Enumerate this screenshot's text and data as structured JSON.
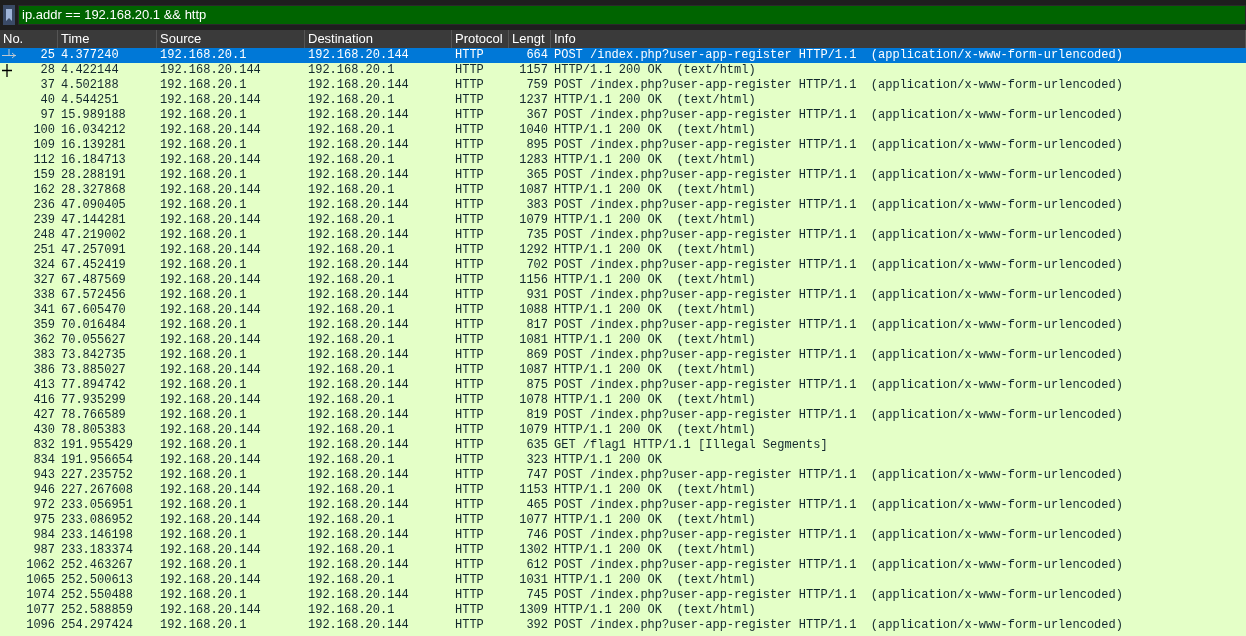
{
  "filter": {
    "value": "ip.addr == 192.168.20.1 && http"
  },
  "table": {
    "columns": [
      "No.",
      "Time",
      "Source",
      "Destination",
      "Protocol",
      "Lengt",
      "Info"
    ],
    "rows": [
      {
        "no": "25",
        "time": "4.377240",
        "source": "192.168.20.1",
        "destination": "192.168.20.144",
        "protocol": "HTTP",
        "length": "664",
        "info": "POST /index.php?user-app-register HTTP/1.1  (application/x-www-form-urlencoded)",
        "selected": true,
        "kind": "request"
      },
      {
        "no": "28",
        "time": "4.422144",
        "source": "192.168.20.144",
        "destination": "192.168.20.1",
        "protocol": "HTTP",
        "length": "1157",
        "info": "HTTP/1.1 200 OK  (text/html)",
        "selected": false,
        "kind": "response"
      },
      {
        "no": "37",
        "time": "4.502188",
        "source": "192.168.20.1",
        "destination": "192.168.20.144",
        "protocol": "HTTP",
        "length": "759",
        "info": "POST /index.php?user-app-register HTTP/1.1  (application/x-www-form-urlencoded)",
        "selected": false
      },
      {
        "no": "40",
        "time": "4.544251",
        "source": "192.168.20.144",
        "destination": "192.168.20.1",
        "protocol": "HTTP",
        "length": "1237",
        "info": "HTTP/1.1 200 OK  (text/html)",
        "selected": false
      },
      {
        "no": "97",
        "time": "15.989188",
        "source": "192.168.20.1",
        "destination": "192.168.20.144",
        "protocol": "HTTP",
        "length": "367",
        "info": "POST /index.php?user-app-register HTTP/1.1  (application/x-www-form-urlencoded)",
        "selected": false
      },
      {
        "no": "100",
        "time": "16.034212",
        "source": "192.168.20.144",
        "destination": "192.168.20.1",
        "protocol": "HTTP",
        "length": "1040",
        "info": "HTTP/1.1 200 OK  (text/html)",
        "selected": false
      },
      {
        "no": "109",
        "time": "16.139281",
        "source": "192.168.20.1",
        "destination": "192.168.20.144",
        "protocol": "HTTP",
        "length": "895",
        "info": "POST /index.php?user-app-register HTTP/1.1  (application/x-www-form-urlencoded)",
        "selected": false
      },
      {
        "no": "112",
        "time": "16.184713",
        "source": "192.168.20.144",
        "destination": "192.168.20.1",
        "protocol": "HTTP",
        "length": "1283",
        "info": "HTTP/1.1 200 OK  (text/html)",
        "selected": false
      },
      {
        "no": "159",
        "time": "28.288191",
        "source": "192.168.20.1",
        "destination": "192.168.20.144",
        "protocol": "HTTP",
        "length": "365",
        "info": "POST /index.php?user-app-register HTTP/1.1  (application/x-www-form-urlencoded)",
        "selected": false
      },
      {
        "no": "162",
        "time": "28.327868",
        "source": "192.168.20.144",
        "destination": "192.168.20.1",
        "protocol": "HTTP",
        "length": "1087",
        "info": "HTTP/1.1 200 OK  (text/html)",
        "selected": false
      },
      {
        "no": "236",
        "time": "47.090405",
        "source": "192.168.20.1",
        "destination": "192.168.20.144",
        "protocol": "HTTP",
        "length": "383",
        "info": "POST /index.php?user-app-register HTTP/1.1  (application/x-www-form-urlencoded)",
        "selected": false
      },
      {
        "no": "239",
        "time": "47.144281",
        "source": "192.168.20.144",
        "destination": "192.168.20.1",
        "protocol": "HTTP",
        "length": "1079",
        "info": "HTTP/1.1 200 OK  (text/html)",
        "selected": false
      },
      {
        "no": "248",
        "time": "47.219002",
        "source": "192.168.20.1",
        "destination": "192.168.20.144",
        "protocol": "HTTP",
        "length": "735",
        "info": "POST /index.php?user-app-register HTTP/1.1  (application/x-www-form-urlencoded)",
        "selected": false
      },
      {
        "no": "251",
        "time": "47.257091",
        "source": "192.168.20.144",
        "destination": "192.168.20.1",
        "protocol": "HTTP",
        "length": "1292",
        "info": "HTTP/1.1 200 OK  (text/html)",
        "selected": false
      },
      {
        "no": "324",
        "time": "67.452419",
        "source": "192.168.20.1",
        "destination": "192.168.20.144",
        "protocol": "HTTP",
        "length": "702",
        "info": "POST /index.php?user-app-register HTTP/1.1  (application/x-www-form-urlencoded)",
        "selected": false
      },
      {
        "no": "327",
        "time": "67.487569",
        "source": "192.168.20.144",
        "destination": "192.168.20.1",
        "protocol": "HTTP",
        "length": "1156",
        "info": "HTTP/1.1 200 OK  (text/html)",
        "selected": false
      },
      {
        "no": "338",
        "time": "67.572456",
        "source": "192.168.20.1",
        "destination": "192.168.20.144",
        "protocol": "HTTP",
        "length": "931",
        "info": "POST /index.php?user-app-register HTTP/1.1  (application/x-www-form-urlencoded)",
        "selected": false
      },
      {
        "no": "341",
        "time": "67.605470",
        "source": "192.168.20.144",
        "destination": "192.168.20.1",
        "protocol": "HTTP",
        "length": "1088",
        "info": "HTTP/1.1 200 OK  (text/html)",
        "selected": false
      },
      {
        "no": "359",
        "time": "70.016484",
        "source": "192.168.20.1",
        "destination": "192.168.20.144",
        "protocol": "HTTP",
        "length": "817",
        "info": "POST /index.php?user-app-register HTTP/1.1  (application/x-www-form-urlencoded)",
        "selected": false
      },
      {
        "no": "362",
        "time": "70.055627",
        "source": "192.168.20.144",
        "destination": "192.168.20.1",
        "protocol": "HTTP",
        "length": "1081",
        "info": "HTTP/1.1 200 OK  (text/html)",
        "selected": false
      },
      {
        "no": "383",
        "time": "73.842735",
        "source": "192.168.20.1",
        "destination": "192.168.20.144",
        "protocol": "HTTP",
        "length": "869",
        "info": "POST /index.php?user-app-register HTTP/1.1  (application/x-www-form-urlencoded)",
        "selected": false
      },
      {
        "no": "386",
        "time": "73.885027",
        "source": "192.168.20.144",
        "destination": "192.168.20.1",
        "protocol": "HTTP",
        "length": "1087",
        "info": "HTTP/1.1 200 OK  (text/html)",
        "selected": false
      },
      {
        "no": "413",
        "time": "77.894742",
        "source": "192.168.20.1",
        "destination": "192.168.20.144",
        "protocol": "HTTP",
        "length": "875",
        "info": "POST /index.php?user-app-register HTTP/1.1  (application/x-www-form-urlencoded)",
        "selected": false
      },
      {
        "no": "416",
        "time": "77.935299",
        "source": "192.168.20.144",
        "destination": "192.168.20.1",
        "protocol": "HTTP",
        "length": "1078",
        "info": "HTTP/1.1 200 OK  (text/html)",
        "selected": false
      },
      {
        "no": "427",
        "time": "78.766589",
        "source": "192.168.20.1",
        "destination": "192.168.20.144",
        "protocol": "HTTP",
        "length": "819",
        "info": "POST /index.php?user-app-register HTTP/1.1  (application/x-www-form-urlencoded)",
        "selected": false
      },
      {
        "no": "430",
        "time": "78.805383",
        "source": "192.168.20.144",
        "destination": "192.168.20.1",
        "protocol": "HTTP",
        "length": "1079",
        "info": "HTTP/1.1 200 OK  (text/html)",
        "selected": false
      },
      {
        "no": "832",
        "time": "191.955429",
        "source": "192.168.20.1",
        "destination": "192.168.20.144",
        "protocol": "HTTP",
        "length": "635",
        "info": "GET /flag1 HTTP/1.1 [Illegal Segments]",
        "selected": false
      },
      {
        "no": "834",
        "time": "191.956654",
        "source": "192.168.20.144",
        "destination": "192.168.20.1",
        "protocol": "HTTP",
        "length": "323",
        "info": "HTTP/1.1 200 OK",
        "selected": false
      },
      {
        "no": "943",
        "time": "227.235752",
        "source": "192.168.20.1",
        "destination": "192.168.20.144",
        "protocol": "HTTP",
        "length": "747",
        "info": "POST /index.php?user-app-register HTTP/1.1  (application/x-www-form-urlencoded)",
        "selected": false
      },
      {
        "no": "946",
        "time": "227.267608",
        "source": "192.168.20.144",
        "destination": "192.168.20.1",
        "protocol": "HTTP",
        "length": "1153",
        "info": "HTTP/1.1 200 OK  (text/html)",
        "selected": false
      },
      {
        "no": "972",
        "time": "233.056951",
        "source": "192.168.20.1",
        "destination": "192.168.20.144",
        "protocol": "HTTP",
        "length": "465",
        "info": "POST /index.php?user-app-register HTTP/1.1  (application/x-www-form-urlencoded)",
        "selected": false
      },
      {
        "no": "975",
        "time": "233.086952",
        "source": "192.168.20.144",
        "destination": "192.168.20.1",
        "protocol": "HTTP",
        "length": "1077",
        "info": "HTTP/1.1 200 OK  (text/html)",
        "selected": false
      },
      {
        "no": "984",
        "time": "233.146198",
        "source": "192.168.20.1",
        "destination": "192.168.20.144",
        "protocol": "HTTP",
        "length": "746",
        "info": "POST /index.php?user-app-register HTTP/1.1  (application/x-www-form-urlencoded)",
        "selected": false
      },
      {
        "no": "987",
        "time": "233.183374",
        "source": "192.168.20.144",
        "destination": "192.168.20.1",
        "protocol": "HTTP",
        "length": "1302",
        "info": "HTTP/1.1 200 OK  (text/html)",
        "selected": false
      },
      {
        "no": "1062",
        "time": "252.463267",
        "source": "192.168.20.1",
        "destination": "192.168.20.144",
        "protocol": "HTTP",
        "length": "612",
        "info": "POST /index.php?user-app-register HTTP/1.1  (application/x-www-form-urlencoded)",
        "selected": false
      },
      {
        "no": "1065",
        "time": "252.500613",
        "source": "192.168.20.144",
        "destination": "192.168.20.1",
        "protocol": "HTTP",
        "length": "1031",
        "info": "HTTP/1.1 200 OK  (text/html)",
        "selected": false
      },
      {
        "no": "1074",
        "time": "252.550488",
        "source": "192.168.20.1",
        "destination": "192.168.20.144",
        "protocol": "HTTP",
        "length": "745",
        "info": "POST /index.php?user-app-register HTTP/1.1  (application/x-www-form-urlencoded)",
        "selected": false
      },
      {
        "no": "1077",
        "time": "252.588859",
        "source": "192.168.20.144",
        "destination": "192.168.20.1",
        "protocol": "HTTP",
        "length": "1309",
        "info": "HTTP/1.1 200 OK  (text/html)",
        "selected": false
      },
      {
        "no": "1096",
        "time": "254.297424",
        "source": "192.168.20.1",
        "destination": "192.168.20.144",
        "protocol": "HTTP",
        "length": "392",
        "info": "POST /index.php?user-app-register HTTP/1.1  (application/x-www-form-urlencoded)",
        "selected": false
      }
    ]
  }
}
